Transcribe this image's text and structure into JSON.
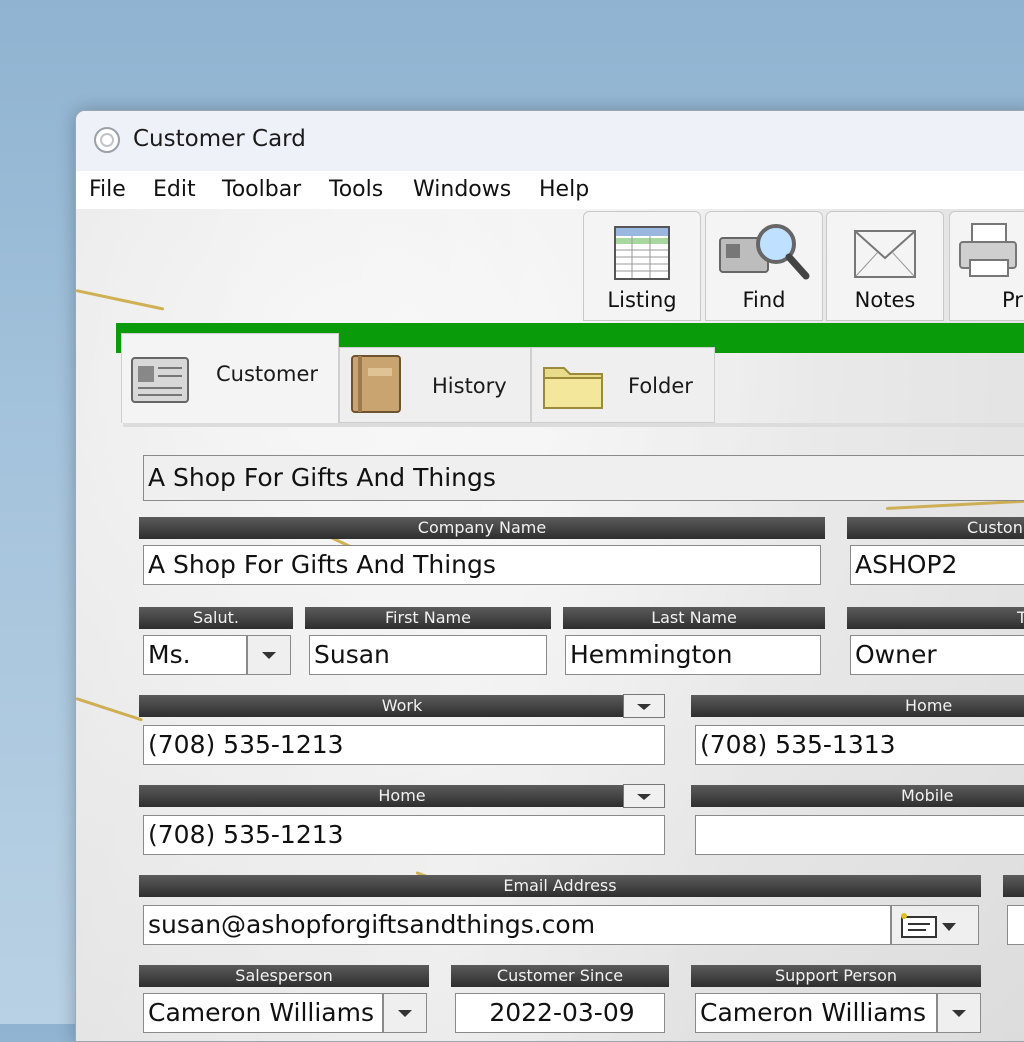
{
  "window": {
    "title": "Customer Card"
  },
  "menu": [
    "File",
    "Edit",
    "Toolbar",
    "Tools",
    "Windows",
    "Help"
  ],
  "toolbar": {
    "listing": "Listing",
    "find": "Find",
    "notes": "Notes",
    "print": "Prin"
  },
  "tabs": {
    "customer": "Customer",
    "history": "History",
    "folder": "Folder"
  },
  "record": {
    "display_name": "A Shop For Gifts And Things"
  },
  "fields": {
    "company_name": {
      "label": "Company Name",
      "value": "A Shop For Gifts And Things"
    },
    "customer_id": {
      "label": "Custon",
      "value": "ASHOP2"
    },
    "salutation": {
      "label": "Salut.",
      "value": "Ms."
    },
    "first_name": {
      "label": "First Name",
      "value": "Susan"
    },
    "last_name": {
      "label": "Last Name",
      "value": "Hemmington"
    },
    "title": {
      "label": "T",
      "value": "Owner"
    },
    "phone1": {
      "label": "Work",
      "value": "(708) 535-1213"
    },
    "phone2": {
      "label": "Home",
      "value": "(708) 535-1313"
    },
    "phone3": {
      "label": "Home",
      "value": "(708) 535-1213"
    },
    "phone4": {
      "label": "Mobile",
      "value": ""
    },
    "email": {
      "label": "Email Address",
      "value": "susan@ashopforgiftsandthings.com"
    },
    "salesperson": {
      "label": "Salesperson",
      "value": "Cameron Williams"
    },
    "customer_since": {
      "label": "Customer Since",
      "value": "2022-03-09"
    },
    "support_person": {
      "label": "Support Person",
      "value": "Cameron Williams"
    }
  },
  "colors": {
    "accent_green": "#0a9b0a",
    "header_dark": "#3a3a3a",
    "vein_gold": "#c9a53a"
  }
}
